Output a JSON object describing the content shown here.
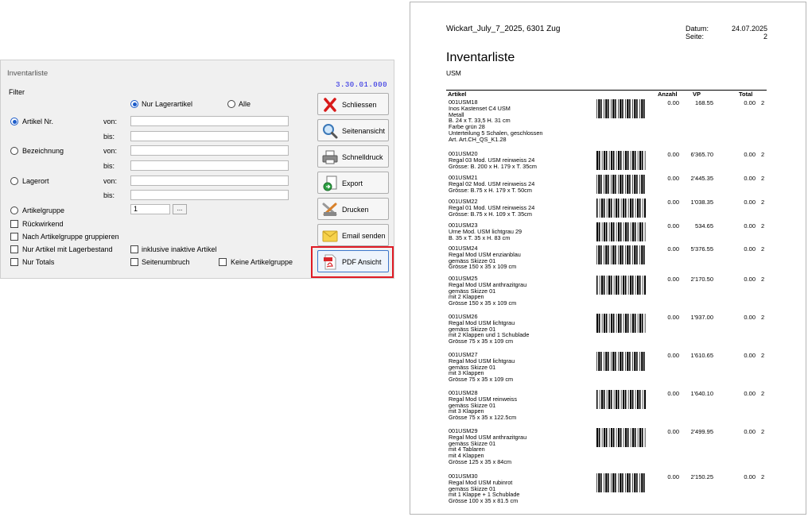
{
  "dialog": {
    "title": "Inventarliste",
    "version": "3.30.01.000",
    "filter_label": "Filter",
    "top_radio": [
      {
        "label": "Nur Lagerartikel",
        "checked": true
      },
      {
        "label": "Alle",
        "checked": false
      }
    ],
    "criteria": [
      {
        "label": "Artikel Nr.",
        "checked": true,
        "from_label": "von:",
        "to_label": "bis:"
      },
      {
        "label": "Bezeichnung",
        "checked": false,
        "from_label": "von:",
        "to_label": "bis:"
      },
      {
        "label": "Lagerort",
        "checked": false,
        "from_label": "von:",
        "to_label": "bis:"
      }
    ],
    "artikelgruppe": {
      "label": "Artikelgruppe",
      "value": "1",
      "browse": "..."
    },
    "checkboxes": {
      "rueckwirkend": "Rückwirkend",
      "nach_gruppe": "Nach Artikelgruppe gruppieren",
      "nur_lagerbestand": "Nur Artikel mit Lagerbestand",
      "inaktive": "inklusive inaktive Artikel",
      "nur_totals": "Nur Totals",
      "seitenumbruch": "Seitenumbruch",
      "keine_gruppe": "Keine Artikelgruppe"
    },
    "buttons": [
      {
        "label": "Schliessen",
        "icon": "close-x-icon"
      },
      {
        "label": "Seitenansicht",
        "icon": "magnifier-icon"
      },
      {
        "label": "Schnelldruck",
        "icon": "printer-icon"
      },
      {
        "label": "Export",
        "icon": "export-icon"
      },
      {
        "label": "Drucken",
        "icon": "print-tools-icon"
      },
      {
        "label": "Email senden",
        "icon": "envelope-icon"
      },
      {
        "label": "PDF Ansicht",
        "icon": "pdf-icon"
      }
    ],
    "highlight_color": "#e01b24"
  },
  "report": {
    "company": "Wickart_July_7_2025, 6301 Zug",
    "datum_label": "Datum:",
    "datum_value": "24.07.2025",
    "seite_label": "Seite:",
    "seite_value": "2",
    "title": "Inventarliste",
    "subtitle": "USM",
    "columns": {
      "artikel": "Artikel",
      "anzahl": "Anzahl",
      "vp": "VP",
      "total": "Total"
    },
    "items": [
      {
        "lines": [
          "001USM18",
          "Inos Kastenset C4 USM",
          "Metall",
          "B. 24 x T. 33,5 H. 31 cm",
          "Farbe grün 28",
          "Unterteilung 5 Schalen, geschlossen",
          "Art. Art.CH_QS_K1.28"
        ],
        "anzahl": "0.00",
        "vp": "168.55",
        "total": "0.00",
        "page": "2"
      },
      {
        "lines": [
          "001USM20",
          "Regal 03 Mod. USM reinweiss 24",
          "Grösse: B. 200 x H. 179 x T. 35cm"
        ],
        "anzahl": "0.00",
        "vp": "6'365.70",
        "total": "0.00",
        "page": "2"
      },
      {
        "lines": [
          "001USM21",
          "Regal 02 Mod. USM reinweiss 24",
          "Grösse: B.75 x H. 179 x T. 50cm"
        ],
        "anzahl": "0.00",
        "vp": "2'445.35",
        "total": "0.00",
        "page": "2"
      },
      {
        "lines": [
          "001USM22",
          "Regal 01 Mod. USM reinweiss 24",
          "Grösse: B.75 x H. 109 x T. 35cm"
        ],
        "anzahl": "0.00",
        "vp": "1'038.35",
        "total": "0.00",
        "page": "2"
      },
      {
        "lines": [
          "001USM23",
          "Urne Mod. USM lichtgrau 29",
          "B. 35 x T. 35 x H. 83 cm"
        ],
        "anzahl": "0.00",
        "vp": "534.65",
        "total": "0.00",
        "page": "2"
      },
      {
        "lines": [
          "001USM24",
          "Regal Mod USM enzianblau",
          "gemäss Skizze 01",
          "Grösse 150 x 35 x 109 cm"
        ],
        "anzahl": "0.00",
        "vp": "5'376.55",
        "total": "0.00",
        "page": "2"
      },
      {
        "lines": [
          "001USM25",
          "Regal Mod USM anthrazitgrau",
          "gemäss Skizze 01",
          "mit 2 Klappen",
          "Grösse 150 x 35 x 109 cm"
        ],
        "anzahl": "0.00",
        "vp": "2'170.50",
        "total": "0.00",
        "page": "2"
      },
      {
        "lines": [
          "001USM26",
          "Regal Mod USM lichtgrau",
          "gemäss Skizze 01",
          "mit 2 Klappen und 1 Schublade",
          "Grösse 75 x 35 x 109 cm"
        ],
        "anzahl": "0.00",
        "vp": "1'937.00",
        "total": "0.00",
        "page": "2"
      },
      {
        "lines": [
          "001USM27",
          "Regal Mod USM lichtgrau",
          "gemäss Skizze 01",
          "mit 3 Klappen",
          "Grösse 75 x 35 x 109 cm"
        ],
        "anzahl": "0.00",
        "vp": "1'610.65",
        "total": "0.00",
        "page": "2"
      },
      {
        "lines": [
          "001USM28",
          "Regal Mod USM reinweiss",
          "gemäss Skizze 01",
          "mit 3 Klappen",
          "Grösse 75 x 35 x 122.5cm"
        ],
        "anzahl": "0.00",
        "vp": "1'640.10",
        "total": "0.00",
        "page": "2"
      },
      {
        "lines": [
          "001USM29",
          "Regal Mod USM anthrazitgrau",
          "gemäss Skizze 01",
          "mit 4 Tablaren",
          "mit 4  Klappen",
          "Grösse 125 x 35 x 84cm"
        ],
        "anzahl": "0.00",
        "vp": "2'499.95",
        "total": "0.00",
        "page": "2"
      },
      {
        "lines": [
          "001USM30",
          "Regal Mod USM rubinrot",
          "gemäss Skizze 01",
          "mit 1 Klappe + 1 Schublade",
          "Grösse 100 x 35 x 81.5 cm"
        ],
        "anzahl": "0.00",
        "vp": "2'150.25",
        "total": "0.00",
        "page": "2"
      }
    ]
  }
}
